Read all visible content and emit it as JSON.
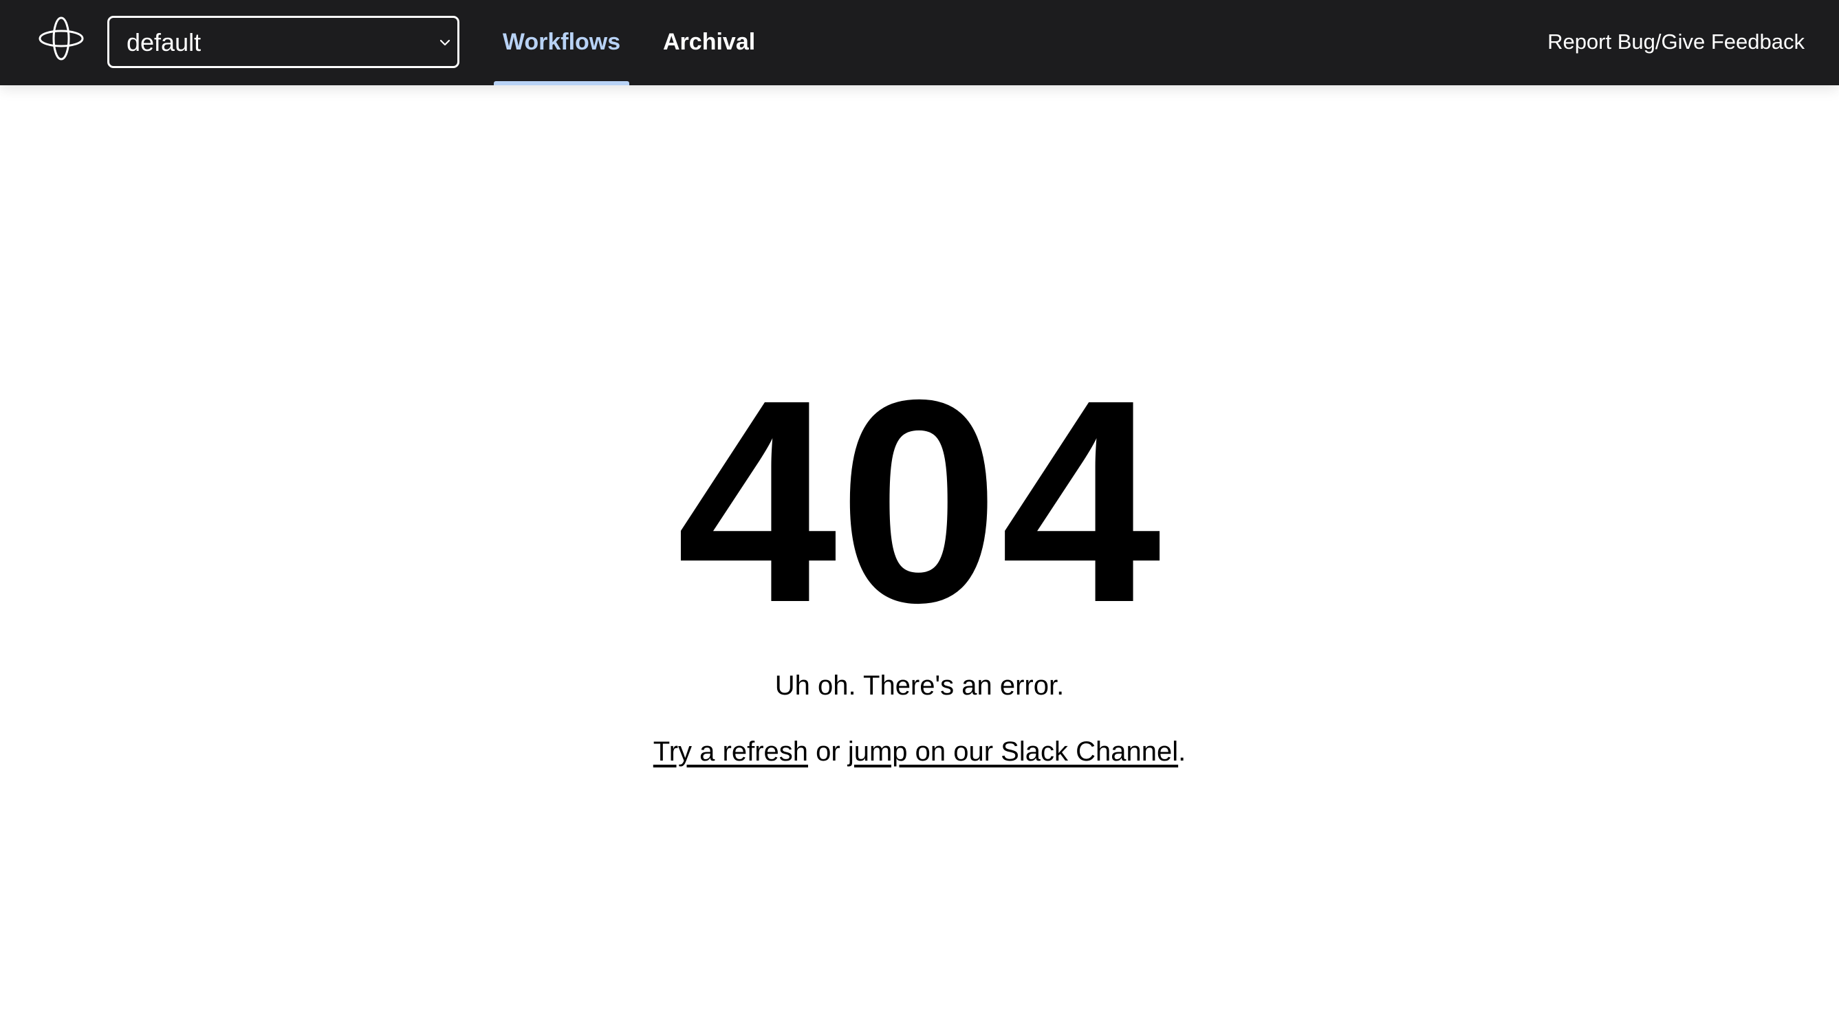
{
  "header": {
    "logo_icon": "temporal-logo-icon",
    "namespace_select": {
      "value": "default",
      "icon": "chevron-down-icon"
    },
    "tabs": [
      {
        "label": "Workflows",
        "active": true
      },
      {
        "label": "Archival",
        "active": false
      }
    ],
    "feedback_link": "Report Bug/Give Feedback"
  },
  "main": {
    "code": "404",
    "message": "Uh oh. There's an error.",
    "help": {
      "refresh_link": "Try a refresh",
      "connector": "or",
      "slack_link": "jump on our Slack Channel",
      "end": "."
    }
  },
  "colors": {
    "topbar_bg": "#1c1c1e",
    "active_tab": "#b8d2f5",
    "text": "#000000"
  }
}
